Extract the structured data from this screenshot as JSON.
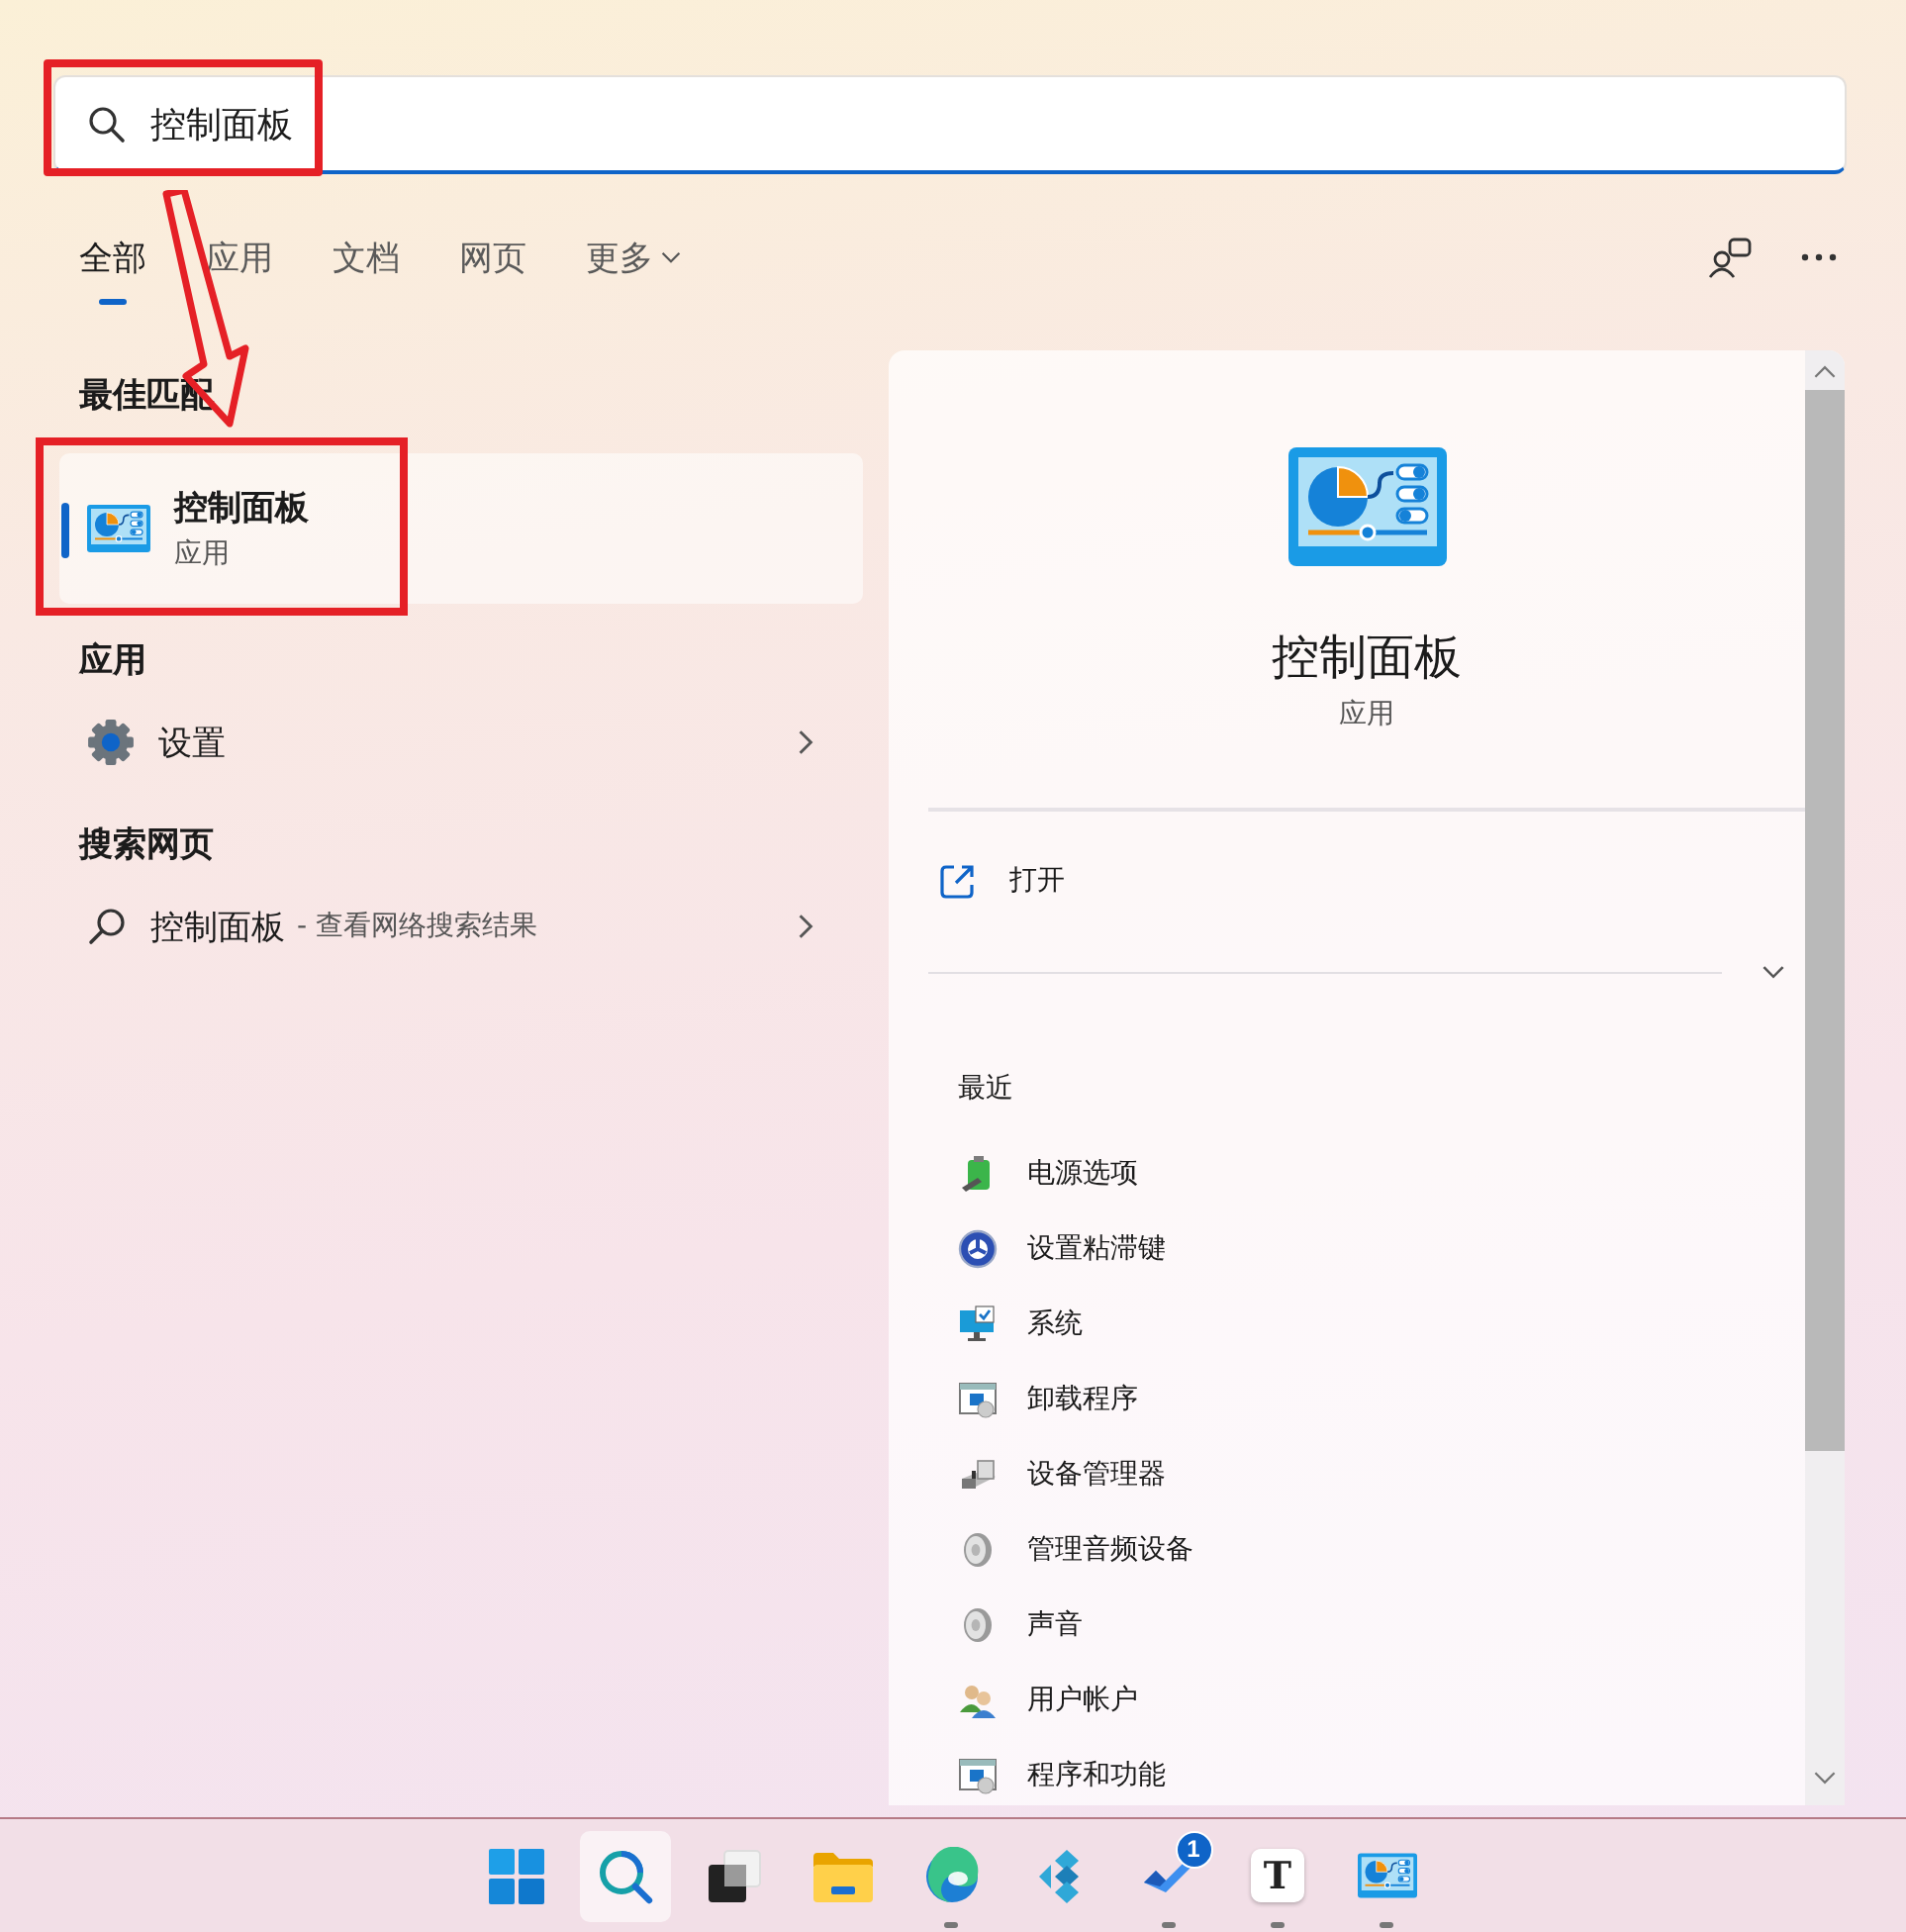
{
  "search": {
    "value": "控制面板",
    "highlighted": true
  },
  "tabs": [
    {
      "label": "全部",
      "selected": true,
      "kind": "tab"
    },
    {
      "label": "应用",
      "selected": false,
      "kind": "tab"
    },
    {
      "label": "文档",
      "selected": false,
      "kind": "tab"
    },
    {
      "label": "网页",
      "selected": false,
      "kind": "tab"
    },
    {
      "label": "更多",
      "selected": false,
      "kind": "dropdown"
    }
  ],
  "best_match": {
    "heading": "最佳匹配",
    "title": "控制面板",
    "subtitle": "应用",
    "selected": true,
    "highlighted": true
  },
  "apps": {
    "heading": "应用",
    "items": [
      {
        "label": "设置"
      }
    ]
  },
  "web": {
    "heading": "搜索网页",
    "items": [
      {
        "label": "控制面板",
        "hint": "- 查看网络搜索结果"
      }
    ]
  },
  "annotation_arrow": true,
  "detail": {
    "title": "控制面板",
    "subtitle": "应用",
    "actions": [
      {
        "label": "打开"
      }
    ],
    "recent_heading": "最近",
    "recent": [
      {
        "label": "电源选项",
        "kind": "power"
      },
      {
        "label": "设置粘滞键",
        "kind": "accessibility"
      },
      {
        "label": "系统",
        "kind": "system"
      },
      {
        "label": "卸载程序",
        "kind": "programs"
      },
      {
        "label": "设备管理器",
        "kind": "device"
      },
      {
        "label": "管理音频设备",
        "kind": "speaker"
      },
      {
        "label": "声音",
        "kind": "speaker"
      },
      {
        "label": "用户帐户",
        "kind": "users"
      },
      {
        "label": "程序和功能",
        "kind": "programs"
      }
    ]
  },
  "taskbar": [
    {
      "kind": "start",
      "selected": false,
      "running": false
    },
    {
      "kind": "search",
      "selected": true,
      "running": false
    },
    {
      "kind": "taskview",
      "selected": false,
      "running": false
    },
    {
      "kind": "explorer",
      "selected": false,
      "running": false
    },
    {
      "kind": "browser",
      "selected": false,
      "running": true
    },
    {
      "kind": "media",
      "selected": false,
      "running": false
    },
    {
      "kind": "todo",
      "selected": false,
      "running": true,
      "badge": "1"
    },
    {
      "kind": "text-editor",
      "selected": false,
      "running": true,
      "glyph": "T"
    },
    {
      "kind": "control-panel",
      "selected": false,
      "running": true
    }
  ]
}
